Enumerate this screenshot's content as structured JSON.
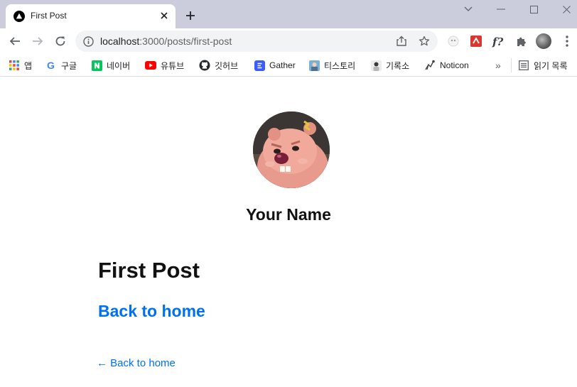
{
  "browser": {
    "tab": {
      "title": "First Post",
      "favicon": "nextjs-triangle-icon",
      "close": "close-icon"
    },
    "new_tab": "plus-icon",
    "window_controls": [
      "chevron-down-icon",
      "minimize-icon",
      "maximize-icon",
      "close-icon"
    ],
    "address": {
      "host": "localhost",
      "rest": ":3000/posts/first-post"
    },
    "bookmarks": [
      {
        "label": "앱",
        "icon": "apps-grid-icon"
      },
      {
        "label": "구글",
        "icon": "google-icon"
      },
      {
        "label": "네이버",
        "icon": "naver-icon"
      },
      {
        "label": "유튜브",
        "icon": "youtube-icon"
      },
      {
        "label": "깃허브",
        "icon": "github-icon"
      },
      {
        "label": "Gather",
        "icon": "gather-icon"
      },
      {
        "label": "티스토리",
        "icon": "tistory-icon"
      },
      {
        "label": "기록소",
        "icon": "blog-icon"
      },
      {
        "label": "Noticon",
        "icon": "noticon-icon"
      }
    ],
    "overflow": "»",
    "reading_list": "읽기 목록"
  },
  "page": {
    "name": "Your Name",
    "post_title": "First Post",
    "home_link_big": "Back to home",
    "home_link_small": "← Back to home"
  },
  "colors": {
    "link": "#0070f3",
    "titlebar": "#cbcddd",
    "omnibox": "#f1f3f4"
  }
}
